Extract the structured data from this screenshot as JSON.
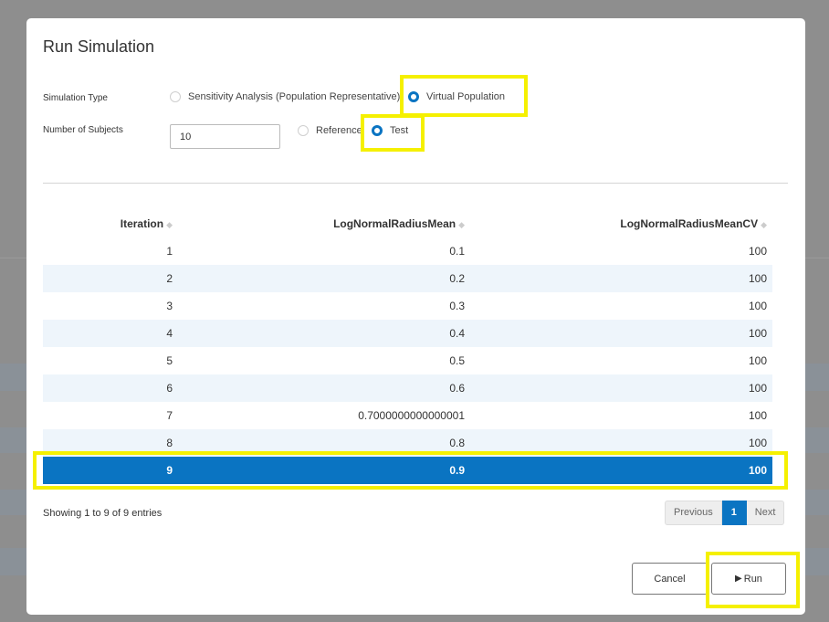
{
  "modal": {
    "title": "Run Simulation"
  },
  "form": {
    "simulation_type_label": "Simulation Type",
    "simulation_type_options": [
      {
        "label": "Sensitivity Analysis (Population Representative)",
        "checked": false
      },
      {
        "label": "Virtual Population",
        "checked": true
      }
    ],
    "number_of_subjects_label": "Number of Subjects",
    "number_of_subjects_value": "10",
    "run_mode_options": [
      {
        "label": "Reference",
        "checked": false
      },
      {
        "label": "Test",
        "checked": true
      }
    ]
  },
  "table": {
    "columns": [
      "Iteration",
      "LogNormalRadiusMean",
      "LogNormalRadiusMeanCV"
    ],
    "sort_icon": "sort-icon",
    "rows": [
      {
        "iteration": "1",
        "mean": "0.1",
        "cv": "100"
      },
      {
        "iteration": "2",
        "mean": "0.2",
        "cv": "100"
      },
      {
        "iteration": "3",
        "mean": "0.3",
        "cv": "100"
      },
      {
        "iteration": "4",
        "mean": "0.4",
        "cv": "100"
      },
      {
        "iteration": "5",
        "mean": "0.5",
        "cv": "100"
      },
      {
        "iteration": "6",
        "mean": "0.6",
        "cv": "100"
      },
      {
        "iteration": "7",
        "mean": "0.7000000000000001",
        "cv": "100"
      },
      {
        "iteration": "8",
        "mean": "0.8",
        "cv": "100"
      },
      {
        "iteration": "9",
        "mean": "0.9",
        "cv": "100"
      }
    ],
    "selected_row": "9",
    "info": "Showing 1 to 9 of 9 entries"
  },
  "pagination": {
    "previous": "Previous",
    "current_page": "1",
    "next": "Next"
  },
  "footer": {
    "cancel_label": "Cancel",
    "run_label": "Run",
    "run_icon": "play-icon"
  },
  "colors": {
    "accent": "#0a74c2",
    "highlight": "#f5f000",
    "row_alt": "#eef5fb"
  }
}
